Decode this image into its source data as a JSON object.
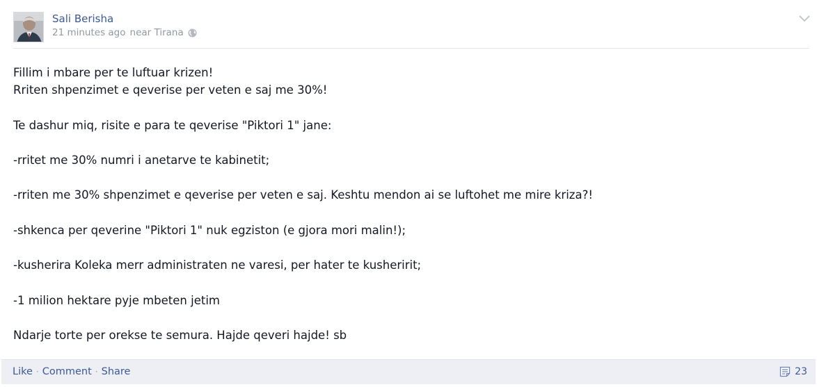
{
  "post": {
    "author": "Sali Berisha",
    "timestamp": "21 minutes ago",
    "location": "near Tirana",
    "privacy_icon": "globe-icon",
    "menu_icon": "chevron-down-icon",
    "lines": [
      "Fillim i mbare per te luftuar krizen!",
      "Rriten shpenzimet e qeverise per veten e saj me 30%!",
      "Te dashur miq, risite e para te qeverise \"Piktori 1\" jane:",
      "-rritet me 30% numri i anetarve te kabinetit;",
      "-rriten me 30% shpenzimet e qeverise per veten e saj. Keshtu mendon ai se luftohet me mire kriza?!",
      "-shkenca per qeverine \"Piktori 1\" nuk egziston (e gjora mori malin!);",
      "-kusherira Koleka merr administraten ne varesi, per hater te kusheririt;",
      "-1 milion hektare pyje mbeten jetim",
      "Ndarje torte per orekse te semura. Hajde qeveri hajde! sb"
    ]
  },
  "footer": {
    "like": "Like",
    "comment": "Comment",
    "share": "Share",
    "separator": "·",
    "comment_count": "23",
    "comment_icon": "comment-icon"
  },
  "colors": {
    "link": "#3b5998",
    "meta": "#9197a3",
    "footer_bg": "#edeff4"
  }
}
